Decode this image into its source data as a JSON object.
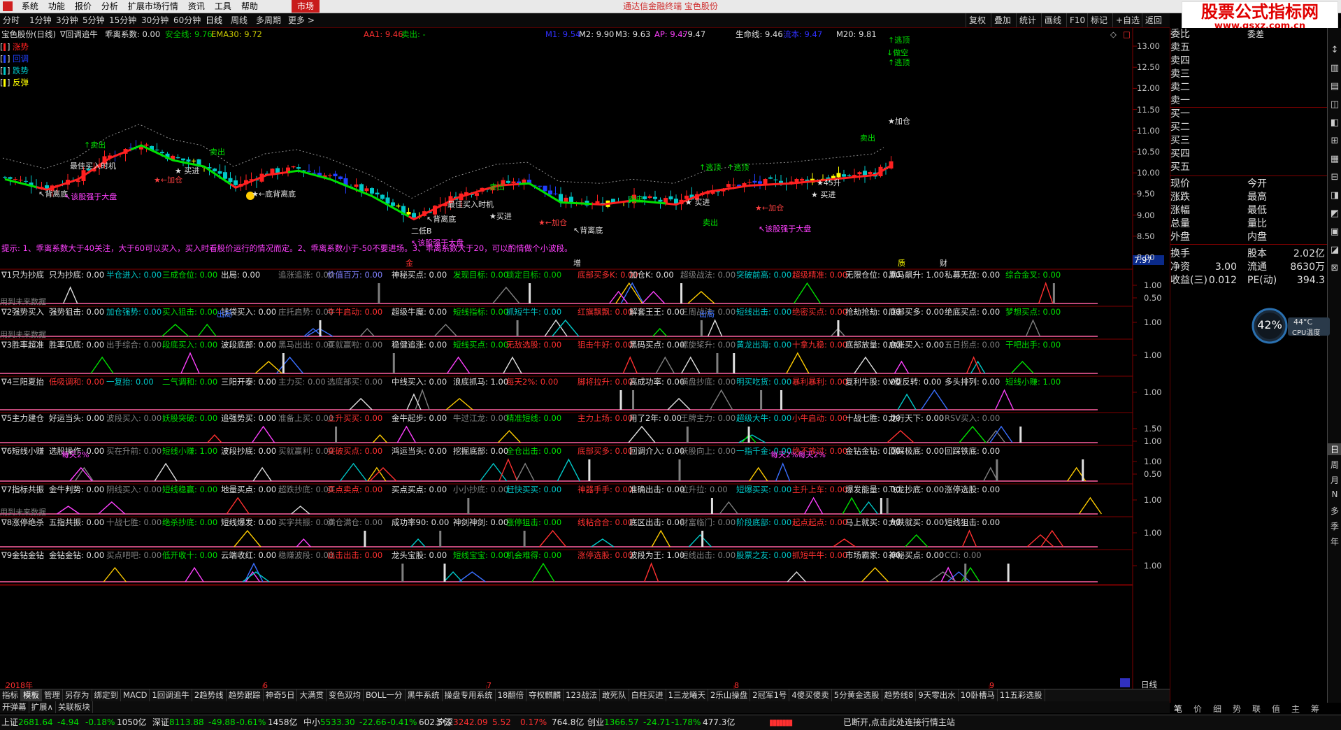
{
  "app": {
    "title": "通达信金融终端 宝色股份",
    "market_tab": "市场"
  },
  "menu": [
    "系统",
    "功能",
    "报价",
    "分析",
    "扩展市场行情",
    "资讯",
    "工具",
    "帮助"
  ],
  "watermark": {
    "title": "股票公式指标网",
    "url": "www.gsxz.com.cn"
  },
  "period_bar": {
    "periods": [
      "分时",
      "1分钟",
      "3分钟",
      "5分钟",
      "15分钟",
      "30分钟",
      "60分钟",
      "日线",
      "周线",
      "多周期",
      "更多 >"
    ],
    "right_buttons": [
      "复权",
      "叠加",
      "统计",
      "画线",
      "F10",
      "标记",
      "+自选",
      "返回"
    ]
  },
  "main_header": {
    "stock": "宝色股份(日线)",
    "indicator": "∇回调追牛",
    "items": [
      {
        "t": "乖离系数: 0.00",
        "c": "#e0e0e0"
      },
      {
        "t": "安全线: 9.76",
        "c": "#00c800"
      },
      {
        "t": "EMA30: 9.72",
        "c": "#c8c800"
      },
      {
        "t": "AA1: 9.46",
        "c": "#ff3030"
      },
      {
        "t": "卖出: -",
        "c": "#00c800"
      },
      {
        "t": "M1: 9.54",
        "c": "#3030ff"
      },
      {
        "t": "M2: 9.90",
        "c": "#e0e0e0"
      },
      {
        "t": "M3: 9.63",
        "c": "#e0e0e0"
      },
      {
        "t": "AP: 9.47",
        "c": "#ff40ff"
      },
      {
        "t": ": 9.47",
        "c": "#e0e0e0"
      },
      {
        "t": "生命线: 9.46",
        "c": "#e0e0e0"
      },
      {
        "t": "流本: 9.47",
        "c": "#3030ff"
      },
      {
        "t": "M20: 9.81",
        "c": "#e0e0e0"
      }
    ]
  },
  "legend": [
    {
      "label": "涨势",
      "color": "#ff2020"
    },
    {
      "label": "回调",
      "color": "#2040ff"
    },
    {
      "label": "跌势",
      "color": "#00c8c8"
    },
    {
      "label": "反弹",
      "color": "#ffff00"
    }
  ],
  "price_axis": [
    "13.00",
    "12.50",
    "12.00",
    "11.50",
    "11.00",
    "10.50",
    "10.00",
    "9.50",
    "9.00",
    "8.50",
    "8.00"
  ],
  "price_tag": "7.97",
  "annotations": [
    {
      "t": "↑卖出",
      "c": "#00e000"
    },
    {
      "t": "最佳买入时机",
      "c": "#e0e0e0"
    },
    {
      "t": "★ 买进",
      "c": "#e0e0e0"
    },
    {
      "t": "★←加仓",
      "c": "#ff4040"
    },
    {
      "t": "卖出",
      "c": "#00e000"
    },
    {
      "t": "↖背离底",
      "c": "#e0e0e0"
    },
    {
      "t": "↖该股强于大盘",
      "c": "#ff40ff"
    },
    {
      "t": "★←底背离底",
      "c": "#e0e0e0"
    },
    {
      "t": "↖背离底",
      "c": "#e0e0e0"
    },
    {
      "t": "二低B",
      "c": "#e0e0e0"
    },
    {
      "t": "↖该股强于大盘",
      "c": "#ff40ff"
    },
    {
      "t": "最佳买入时机",
      "c": "#e0e0e0"
    },
    {
      "t": "卖出",
      "c": "#00e000"
    },
    {
      "t": "★买进",
      "c": "#e0e0e0"
    },
    {
      "t": "★←加仓",
      "c": "#ff4040"
    },
    {
      "t": "↖背离底",
      "c": "#e0e0e0"
    },
    {
      "t": "卖出",
      "c": "#00e000"
    },
    {
      "t": "★ 买进",
      "c": "#e0e0e0"
    },
    {
      "t": "↑逃顶",
      "c": "#00e000"
    },
    {
      "t": "↑逃顶",
      "c": "#00e000"
    },
    {
      "t": "卖出",
      "c": "#00e000"
    },
    {
      "t": "★←加仓",
      "c": "#ff4040"
    },
    {
      "t": "↖该股强于大盘",
      "c": "#ff40ff"
    },
    {
      "t": "★ 买进",
      "c": "#e0e0e0"
    },
    {
      "t": "★45升",
      "c": "#e0e0e0"
    },
    {
      "t": "卖出",
      "c": "#00e000"
    },
    {
      "t": "↑逃顶",
      "c": "#00e000"
    },
    {
      "t": "↓做空",
      "c": "#00e000"
    },
    {
      "t": "↑逃顶",
      "c": "#00e000"
    },
    {
      "t": "★加仓",
      "c": "#e0e0e0"
    }
  ],
  "hint_text": "提示: 1、乖离系数大于40关注，大于60可以买入，买入时看股价运行的情况而定。2、乖离系数小于-50不要进场。3、乖离系数大于20，可以酌情做个小波段。",
  "tick_marks": [
    {
      "t": "金",
      "c": "#ff3030"
    },
    {
      "t": "增",
      "c": "#e0e0e0"
    },
    {
      "t": "质",
      "c": "#ffff00"
    },
    {
      "t": "财",
      "c": "#e0e0e0"
    }
  ],
  "panels": [
    {
      "title": "∇1只为抄底",
      "items": [
        {
          "t": "只为抄底: 0.00",
          "c": "#e0e0e0"
        },
        {
          "t": "半仓进入: 0.00",
          "c": "#00c8c8"
        },
        {
          "t": "三成仓位: 0.00",
          "c": "#00e000"
        },
        {
          "t": "出局: 0.00",
          "c": "#e0e0e0"
        },
        {
          "t": "追涨追涨: 0.00",
          "c": "#808080"
        },
        {
          "t": "价值百万: 0.00",
          "c": "#8080ff"
        },
        {
          "t": "神秘买点: 0.00",
          "c": "#e0e0e0"
        },
        {
          "t": "发现目标: 0.00",
          "c": "#00e000"
        },
        {
          "t": "锁定目标: 0.00",
          "c": "#00c800"
        },
        {
          "t": "底部买多K: 0.00",
          "c": "#ff3030"
        },
        {
          "t": "加仓K: 0.00",
          "c": "#e0e0e0"
        },
        {
          "t": "超级战法: 0.00",
          "c": "#808080"
        },
        {
          "t": "突破前高: 0.00",
          "c": "#00c8c8"
        },
        {
          "t": "超级精准: 0.00",
          "c": "#ff3030"
        },
        {
          "t": "无限仓位: 0.00",
          "c": "#e0e0e0"
        },
        {
          "t": "黑马飙升: 1.00",
          "c": "#e0e0e0"
        },
        {
          "t": "私募无敌: 0.00",
          "c": "#e0e0e0"
        },
        {
          "t": "综合金叉: 0.00",
          "c": "#00e000"
        }
      ],
      "axis": [
        "1.00",
        "0.50"
      ],
      "note": "用到未来数据"
    },
    {
      "title": "∇2强势买入",
      "items": [
        {
          "t": "强势狙击: 0.00",
          "c": "#e0e0e0"
        },
        {
          "t": "加仓强势: 0.00",
          "c": "#00c8c8"
        },
        {
          "t": "买入狙击: 0.00",
          "c": "#00e000"
        },
        {
          "t": "钱袋买入: 0.00",
          "c": "#e0e0e0"
        },
        {
          "t": "庄托启势: 0.00",
          "c": "#808080"
        },
        {
          "t": "牛牛启动: 0.00",
          "c": "#ff3030"
        },
        {
          "t": "超级牛魔: 0.00",
          "c": "#e0e0e0"
        },
        {
          "t": "短线指标: 0.00",
          "c": "#00e000"
        },
        {
          "t": "抓短牛牛: 0.00",
          "c": "#00c8c8"
        },
        {
          "t": "红旗飘飘: 0.00",
          "c": "#ff3030"
        },
        {
          "t": "解套王王: 0.00",
          "c": "#e0e0e0"
        },
        {
          "t": "三周战法: 0.00",
          "c": "#808080"
        },
        {
          "t": "短线出击: 0.00",
          "c": "#00c8c8"
        },
        {
          "t": "绝密买点: 0.00",
          "c": "#ff3030"
        },
        {
          "t": "抢劫抢劫: 0.00",
          "c": "#e0e0e0"
        },
        {
          "t": "底部买多: 0.00",
          "c": "#e0e0e0"
        },
        {
          "t": "绝底买点: 0.00",
          "c": "#e0e0e0"
        },
        {
          "t": "梦想买点: 0.00",
          "c": "#00e000"
        }
      ],
      "axis": [
        "1.00"
      ],
      "note": "用到未来数据"
    },
    {
      "title": "∇3胜率超准",
      "items": [
        {
          "t": "胜率见底: 0.00",
          "c": "#e0e0e0"
        },
        {
          "t": "出手综合: 0.00",
          "c": "#808080"
        },
        {
          "t": "段底买入: 0.00",
          "c": "#00e000"
        },
        {
          "t": "波段底部: 0.00",
          "c": "#e0e0e0"
        },
        {
          "t": "黑马出出: 0.00",
          "c": "#808080"
        },
        {
          "t": "买就赢啦: 0.00",
          "c": "#808080"
        },
        {
          "t": "稳健追涨: 0.00",
          "c": "#e0e0e0"
        },
        {
          "t": "短线买点: 0.00",
          "c": "#00e000"
        },
        {
          "t": "无敌选股: 0.00",
          "c": "#ff3030"
        },
        {
          "t": "狙击牛好: 0.00",
          "c": "#ff3030"
        },
        {
          "t": "黑码买点: 0.00",
          "c": "#e0e0e0"
        },
        {
          "t": "螺旋桨升: 0.00",
          "c": "#808080"
        },
        {
          "t": "黄龙出海: 0.00",
          "c": "#00c8c8"
        },
        {
          "t": "十拿九稳: 0.00",
          "c": "#ff3030"
        },
        {
          "t": "底部放量: 0.00",
          "c": "#e0e0e0"
        },
        {
          "t": "启涨买入: 0.00",
          "c": "#e0e0e0"
        },
        {
          "t": "五日拐点: 0.00",
          "c": "#808080"
        },
        {
          "t": "干吧出手: 0.00",
          "c": "#00e000"
        }
      ],
      "axis": [
        "1.00"
      ],
      "note": ""
    },
    {
      "title": "∇4三阳夏抬",
      "items": [
        {
          "t": "低吸调和: 0.00",
          "c": "#ff3030"
        },
        {
          "t": "一复抬: 0.00",
          "c": "#00c8c8"
        },
        {
          "t": "二气调和: 0.00",
          "c": "#00e000"
        },
        {
          "t": "三阳开泰: 0.00",
          "c": "#e0e0e0"
        },
        {
          "t": "主力买: 0.00",
          "c": "#808080"
        },
        {
          "t": "选底部买: 0.00",
          "c": "#808080"
        },
        {
          "t": "中线买入: 0.00",
          "c": "#e0e0e0"
        },
        {
          "t": "浪底抓马: 1.00",
          "c": "#e0e0e0"
        },
        {
          "t": "每天2%: 0.00",
          "c": "#ff3030"
        },
        {
          "t": "脚将拉升: 0.00",
          "c": "#ff3030"
        },
        {
          "t": "高成功率: 0.00",
          "c": "#e0e0e0"
        },
        {
          "t": "横盘抄底: 0.00",
          "c": "#808080"
        },
        {
          "t": "明买吃货: 0.00",
          "c": "#00c8c8"
        },
        {
          "t": "暴利暴利: 0.00",
          "c": "#ff3030"
        },
        {
          "t": "复利牛股: 0.00",
          "c": "#e0e0e0"
        },
        {
          "t": "V型反转: 0.00",
          "c": "#e0e0e0"
        },
        {
          "t": "多头排列: 0.00",
          "c": "#e0e0e0"
        },
        {
          "t": "短线小赚: 1.00",
          "c": "#00e000"
        }
      ],
      "axis": [
        "1.00"
      ],
      "note": ""
    },
    {
      "title": "∇5主力建仓",
      "items": [
        {
          "t": "好运当头: 0.00",
          "c": "#e0e0e0"
        },
        {
          "t": "波段买入: 0.00",
          "c": "#808080"
        },
        {
          "t": "妖股突破: 0.00",
          "c": "#00e000"
        },
        {
          "t": "追强势买: 0.00",
          "c": "#e0e0e0"
        },
        {
          "t": "准备上买: 0.00",
          "c": "#808080"
        },
        {
          "t": "上升买买: 0.00",
          "c": "#ff3030"
        },
        {
          "t": "金牛起步: 0.00",
          "c": "#e0e0e0"
        },
        {
          "t": "牛过江龙: 0.00",
          "c": "#808080"
        },
        {
          "t": "精准短线: 0.00",
          "c": "#00e000"
        },
        {
          "t": "主力上场: 0.00",
          "c": "#ff3030"
        },
        {
          "t": "用了2年: 0.00",
          "c": "#e0e0e0"
        },
        {
          "t": "王牌主力: 0.00",
          "c": "#808080"
        },
        {
          "t": "超级大牛: 0.00",
          "c": "#00c8c8"
        },
        {
          "t": "小牛启动: 0.00",
          "c": "#ff3030"
        },
        {
          "t": "十战七胜: 0.00",
          "c": "#e0e0e0"
        },
        {
          "t": "龙行天下: 0.00",
          "c": "#e0e0e0"
        },
        {
          "t": "RSV买入: 0.00",
          "c": "#808080"
        }
      ],
      "axis": [
        "1.50",
        "1.00"
      ],
      "note": ""
    },
    {
      "title": "∇6短线小赚",
      "items": [
        {
          "t": "选股操作: 0.00",
          "c": "#e0e0e0"
        },
        {
          "t": "买在升前: 0.00",
          "c": "#808080"
        },
        {
          "t": "短线小赚: 1.00",
          "c": "#00e000"
        },
        {
          "t": "波段抄底: 0.00",
          "c": "#e0e0e0"
        },
        {
          "t": "买就赢利: 0.00",
          "c": "#808080"
        },
        {
          "t": "突破买点: 0.00",
          "c": "#ff3030"
        },
        {
          "t": "鸿运当头: 0.00",
          "c": "#e0e0e0"
        },
        {
          "t": "挖掘底部: 0.00",
          "c": "#e0e0e0"
        },
        {
          "t": "全仓出击: 0.00",
          "c": "#00e000"
        },
        {
          "t": "底部买多: 0.00",
          "c": "#ff3030"
        },
        {
          "t": "回调介入: 0.00",
          "c": "#e0e0e0"
        },
        {
          "t": "妖股向上: 0.00",
          "c": "#808080"
        },
        {
          "t": "一指千金: 0.00",
          "c": "#00c8c8"
        },
        {
          "t": "绝不放过: 0.00",
          "c": "#ff3030"
        },
        {
          "t": "金钻金钻: 0.00",
          "c": "#e0e0e0"
        },
        {
          "t": "回踩极底: 0.00",
          "c": "#e0e0e0"
        },
        {
          "t": "回踩铁底: 0.00",
          "c": "#e0e0e0"
        }
      ],
      "axis": [
        "1.00",
        "0.50"
      ],
      "note": ""
    },
    {
      "title": "∇7指标共振",
      "items": [
        {
          "t": "金牛判势: 0.00",
          "c": "#e0e0e0"
        },
        {
          "t": "阴线买入: 0.00",
          "c": "#808080"
        },
        {
          "t": "短线稳赢: 0.00",
          "c": "#00e000"
        },
        {
          "t": "地量买点: 0.00",
          "c": "#e0e0e0"
        },
        {
          "t": "超跌抄底: 0.00",
          "c": "#808080"
        },
        {
          "t": "买点卖点: 0.00",
          "c": "#ff3030"
        },
        {
          "t": "买点买点: 0.00",
          "c": "#e0e0e0"
        },
        {
          "t": "小小抄底: 0.00",
          "c": "#808080"
        },
        {
          "t": "赶快买买: 0.00",
          "c": "#00c8c8"
        },
        {
          "t": "神器手手: 0.00",
          "c": "#ff3030"
        },
        {
          "t": "准确出击: 0.00",
          "c": "#e0e0e0"
        },
        {
          "t": "拉升拉: 0.00",
          "c": "#808080"
        },
        {
          "t": "短爆买买: 0.00",
          "c": "#00c8c8"
        },
        {
          "t": "主升上车: 0.00",
          "c": "#ff3030"
        },
        {
          "t": "爆发能量: 0.00",
          "c": "#e0e0e0"
        },
        {
          "t": "飞龙抄底: 0.00",
          "c": "#e0e0e0"
        },
        {
          "t": "涨停选股: 0.00",
          "c": "#e0e0e0"
        }
      ],
      "axis": [
        "1.00"
      ],
      "note": "用到未来数据"
    },
    {
      "title": "∇8涨停绝杀",
      "items": [
        {
          "t": "五指共振: 0.00",
          "c": "#e0e0e0"
        },
        {
          "t": "十战七胜: 0.00",
          "c": "#808080"
        },
        {
          "t": "绝杀抄底: 0.00",
          "c": "#00e000"
        },
        {
          "t": "短线爆发: 0.00",
          "c": "#e0e0e0"
        },
        {
          "t": "买字共振: 0.00",
          "c": "#808080"
        },
        {
          "t": "满仓满仓: 0.00",
          "c": "#808080"
        },
        {
          "t": "成功率90: 0.00",
          "c": "#e0e0e0"
        },
        {
          "t": "神剑神剑: 0.00",
          "c": "#e0e0e0"
        },
        {
          "t": "涨停狙击: 0.00",
          "c": "#00e000"
        },
        {
          "t": "线粘合合: 0.00",
          "c": "#ff3030"
        },
        {
          "t": "底区出击: 0.00",
          "c": "#e0e0e0"
        },
        {
          "t": "财富临门: 0.00",
          "c": "#808080"
        },
        {
          "t": "阶段底部: 0.00",
          "c": "#00c8c8"
        },
        {
          "t": "起点起点: 0.00",
          "c": "#ff3030"
        },
        {
          "t": "马上就买: 0.00",
          "c": "#e0e0e0"
        },
        {
          "t": "大跌就买: 0.00",
          "c": "#e0e0e0"
        },
        {
          "t": "短线狙击: 0.00",
          "c": "#e0e0e0"
        }
      ],
      "axis": [
        "1.00"
      ],
      "note": ""
    },
    {
      "title": "∇9金钻金钻",
      "items": [
        {
          "t": "金钻金钻: 0.00",
          "c": "#e0e0e0"
        },
        {
          "t": "买点吧吧: 0.00",
          "c": "#808080"
        },
        {
          "t": "低开收十: 0.00",
          "c": "#00e000"
        },
        {
          "t": "云端收红: 0.00",
          "c": "#e0e0e0"
        },
        {
          "t": "稳赚波段: 0.00",
          "c": "#808080"
        },
        {
          "t": "出击出击: 0.00",
          "c": "#ff3030"
        },
        {
          "t": "龙头宝股: 0.00",
          "c": "#e0e0e0"
        },
        {
          "t": "短线宝宝: 0.00",
          "c": "#00e000"
        },
        {
          "t": "机会难得: 0.00",
          "c": "#00e000"
        },
        {
          "t": "涨停选股: 0.00",
          "c": "#ff3030"
        },
        {
          "t": "波段为王: 1.00",
          "c": "#e0e0e0"
        },
        {
          "t": "短线出击: 0.00",
          "c": "#808080"
        },
        {
          "t": "股票之友: 0.00",
          "c": "#00c8c8"
        },
        {
          "t": "抓短牛牛: 0.00",
          "c": "#ff3030"
        },
        {
          "t": "市场霸家: 0.00",
          "c": "#e0e0e0"
        },
        {
          "t": "神秘买点: 0.00",
          "c": "#e0e0e0"
        },
        {
          "t": "CCI: 0.00",
          "c": "#808080"
        }
      ],
      "axis": [
        "1.00"
      ],
      "note": ""
    }
  ],
  "date_axis": [
    "2018年",
    "6",
    "7",
    "8",
    "9"
  ],
  "period_label": "日线",
  "tabs": [
    "指标",
    "模板",
    "管理",
    "另存为",
    "绑定到",
    "MACD",
    "1回调追牛",
    "2趋势线",
    "趋势跟踪",
    "神奇5日",
    "大满贯",
    "变色双均",
    "BOLL一分",
    "黑牛系统",
    "操盘专用系统",
    "18翻倍",
    "夺权麒麟",
    "123战法",
    "敢死队",
    "白柱买进",
    "1三龙曦天",
    "2乐山操盘",
    "2冠军1号",
    "4傻买傻卖",
    "5分黄金选股",
    "趋势线8",
    "9天零出水",
    "10卧槽马",
    "11五彩选股"
  ],
  "tabs2": [
    "开弹幕",
    "扩展∧",
    "关联板块"
  ],
  "quote_panel": {
    "orderbook": [
      "委比",
      "卖五",
      "卖四",
      "卖三",
      "卖二",
      "卖一",
      "买一",
      "买二",
      "买三",
      "买四",
      "买五"
    ],
    "orderbook_right": "委差",
    "rows": [
      {
        "l": "现价",
        "c": "",
        "m": "今开",
        "r": ""
      },
      {
        "l": "涨跌",
        "c": "",
        "m": "最高",
        "r": ""
      },
      {
        "l": "涨幅",
        "c": "",
        "m": "最低",
        "r": ""
      },
      {
        "l": "总量",
        "c": "",
        "m": "量比",
        "r": ""
      },
      {
        "l": "外盘",
        "c": "",
        "m": "内盘",
        "r": ""
      },
      {
        "l": "换手",
        "c": "",
        "m": "股本",
        "r": "2.02亿"
      },
      {
        "l": "净资",
        "c": "3.00",
        "m": "流通",
        "r": "8630万"
      },
      {
        "l": "收益(三)",
        "c": "0.012",
        "m": "PE(动)",
        "r": "394.3"
      }
    ],
    "bottom_tabs": [
      "笔",
      "价",
      "细",
      "势",
      "联",
      "值",
      "主",
      "筹"
    ]
  },
  "cpu": {
    "percent": "42%",
    "temp": "44°C",
    "label": "CPU温度"
  },
  "right_sidebar": [
    "日",
    "周",
    "月",
    "N",
    "多",
    "季",
    "年"
  ],
  "status": [
    {
      "name": "上证",
      "v": "2681.64",
      "d": "-4.94",
      "p": "-0.18%",
      "a": "1050亿"
    },
    {
      "name": "深证",
      "v": "8113.88",
      "d": "-49.88",
      "p": "-0.61%",
      "a": "1458亿"
    },
    {
      "name": "中小",
      "v": "5533.30",
      "d": "-22.66",
      "p": "-0.41%",
      "a": "602.5亿"
    },
    {
      "name": "沪深",
      "v": "3242.09",
      "d": "5.52",
      "p": "0.17%",
      "a": "764.8亿"
    },
    {
      "name": "创业",
      "v": "1366.57",
      "d": "-24.71",
      "p": "-1.78%",
      "a": "477.3亿"
    }
  ],
  "status_msg": "已断开,点击此处连接行情主站",
  "colors": {
    "up": "#ff2020",
    "down": "#00c8c8",
    "pullback": "#2040ff",
    "rebound": "#ffff00",
    "ma_up": "#ff2020",
    "ma_down": "#00e000"
  }
}
